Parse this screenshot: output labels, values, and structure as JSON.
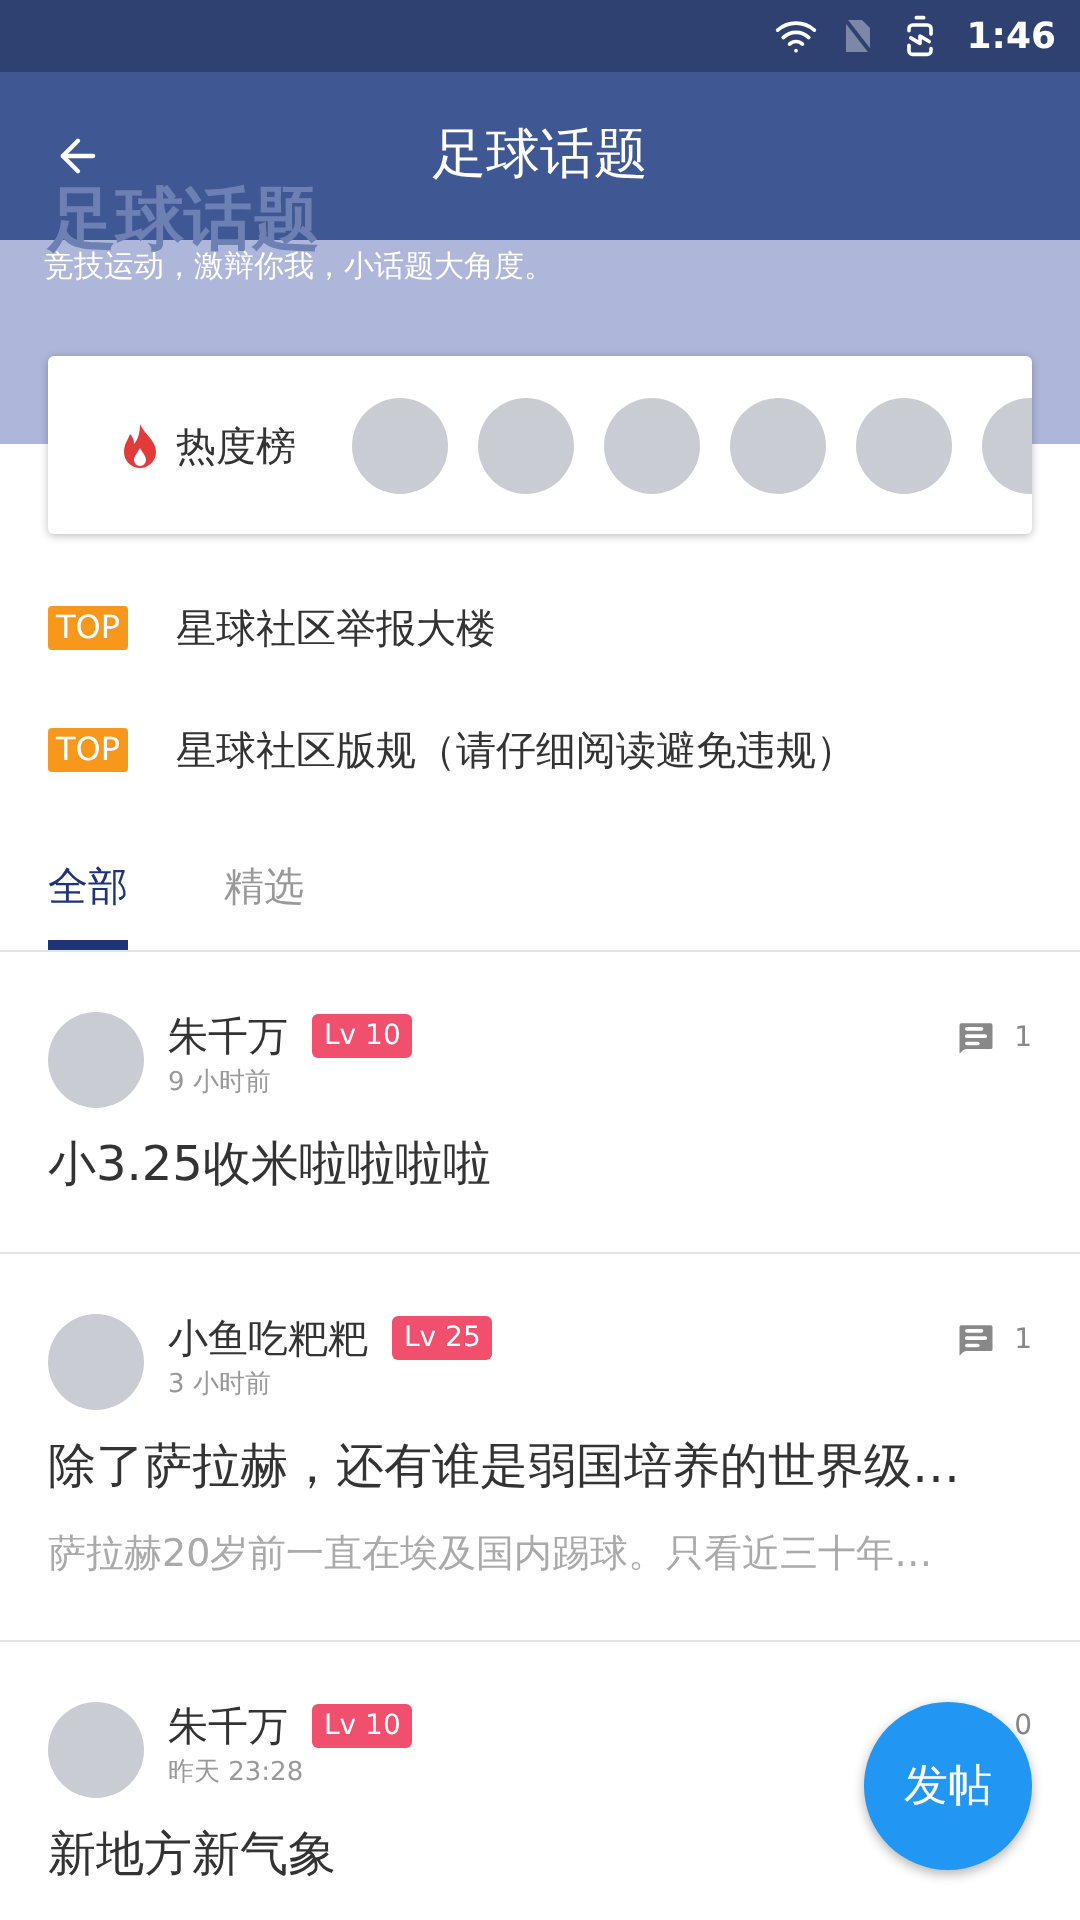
{
  "status_bar": {
    "time": "1:46"
  },
  "app_bar": {
    "title": "足球话题"
  },
  "hero": {
    "title": "足球话题",
    "subtitle": "竞技运动，激辩你我，小话题大角度。"
  },
  "hot_list": {
    "label": "热度榜"
  },
  "pinned": [
    {
      "badge": "TOP",
      "title": "星球社区举报大楼"
    },
    {
      "badge": "TOP",
      "title": "星球社区版规（请仔细阅读避免违规）"
    }
  ],
  "tabs": [
    {
      "label": "全部",
      "selected": true
    },
    {
      "label": "精选",
      "selected": false
    }
  ],
  "posts": [
    {
      "author": "朱千万",
      "level": "Lv 10",
      "time": "9 小时前",
      "comments": "1",
      "title": "小3.25收米啦啦啦啦"
    },
    {
      "author": "小鱼吃粑粑",
      "level": "Lv 25",
      "time": "3 小时前",
      "comments": "1",
      "title": "除了萨拉赫，还有谁是弱国培养的世界级…",
      "excerpt": "萨拉赫20岁前一直在埃及国内踢球。只看近三十年…"
    },
    {
      "author": "朱千万",
      "level": "Lv 10",
      "time": "昨天 23:28",
      "comments": "0",
      "title": "新地方新气象"
    }
  ],
  "fab": {
    "label": "发帖"
  }
}
